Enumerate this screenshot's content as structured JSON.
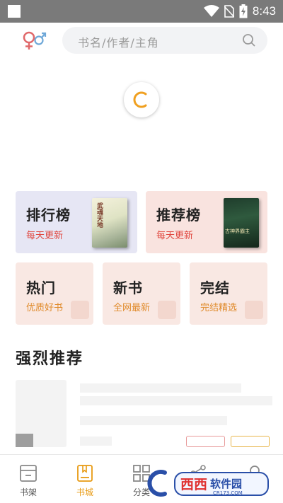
{
  "status_bar": {
    "time": "8:43",
    "icons": [
      "wifi-icon",
      "no-sim-icon",
      "battery-charging-icon"
    ]
  },
  "header": {
    "search_placeholder": "书名/作者/主角",
    "icons": [
      "gender-icon",
      "search-icon"
    ]
  },
  "loading": {
    "icon": "loading-spinner-icon",
    "accent": "#f0a020"
  },
  "rank_cards": [
    {
      "title": "排行榜",
      "subtitle": "每天更新",
      "cover_text": "武魂天地"
    },
    {
      "title": "推荐榜",
      "subtitle": "每天更新",
      "cover_text": "古神界霸主"
    }
  ],
  "category_cards": [
    {
      "title": "热门",
      "subtitle": "优质好书"
    },
    {
      "title": "新书",
      "subtitle": "全网最新"
    },
    {
      "title": "完结",
      "subtitle": "完结精选"
    }
  ],
  "section": {
    "title": "强烈推荐"
  },
  "bottom_nav": {
    "items": [
      {
        "label": "书架",
        "icon": "bookshelf-icon",
        "active": false
      },
      {
        "label": "书城",
        "icon": "bookstore-icon",
        "active": true
      },
      {
        "label": "分类",
        "icon": "category-icon",
        "active": false
      },
      {
        "label": "",
        "icon": "share-icon",
        "active": false
      },
      {
        "label": "",
        "icon": "profile-icon",
        "active": false
      }
    ],
    "active_color": "#e89a12"
  },
  "watermark": {
    "text": "西西软件园",
    "domain": "CR173.COM"
  },
  "colors": {
    "accent": "#e89a12",
    "red": "#e0463e",
    "orange": "#e08a2a"
  }
}
